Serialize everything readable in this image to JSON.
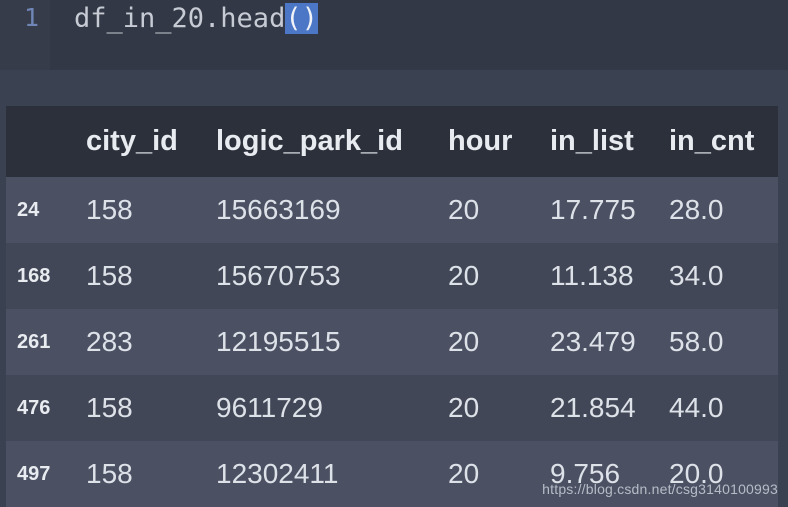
{
  "code_cell": {
    "line_number": "1",
    "code_prefix": "df_in_20.head",
    "code_selected": "()"
  },
  "table": {
    "columns": [
      "city_id",
      "logic_park_id",
      "hour",
      "in_list",
      "in_cnt"
    ],
    "rows": [
      {
        "index": "24",
        "cells": [
          "158",
          "15663169",
          "20",
          "17.775",
          "28.0"
        ]
      },
      {
        "index": "168",
        "cells": [
          "158",
          "15670753",
          "20",
          "11.138",
          "34.0"
        ]
      },
      {
        "index": "261",
        "cells": [
          "283",
          "12195515",
          "20",
          "23.479",
          "58.0"
        ]
      },
      {
        "index": "476",
        "cells": [
          "158",
          "9611729",
          "20",
          "21.854",
          "44.0"
        ]
      },
      {
        "index": "497",
        "cells": [
          "158",
          "12302411",
          "20",
          "9.756",
          "20.0"
        ]
      }
    ]
  },
  "watermark": "https://blog.csdn.net/csg3140100993"
}
